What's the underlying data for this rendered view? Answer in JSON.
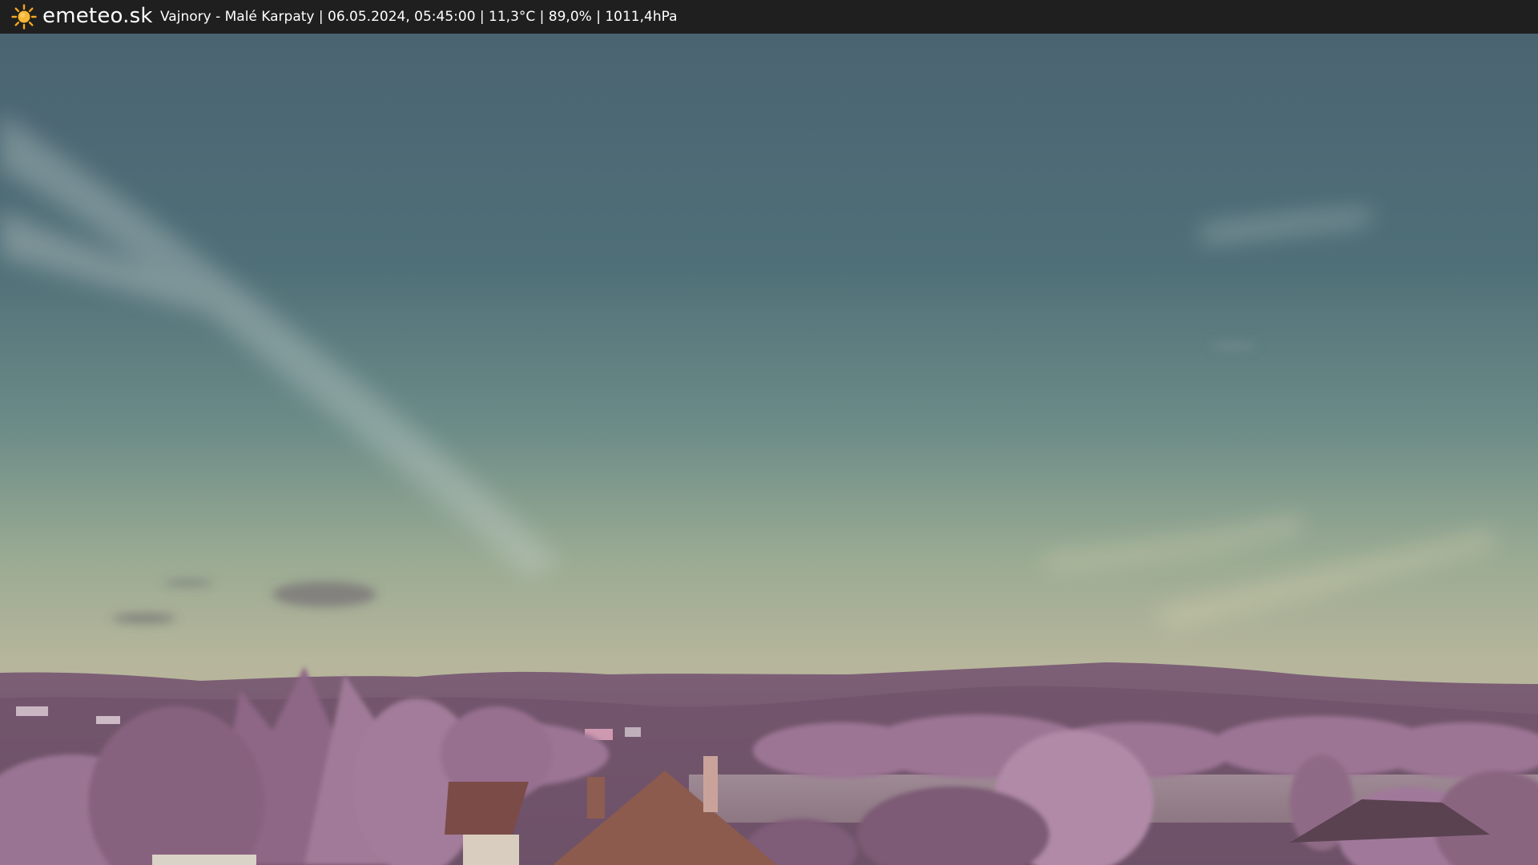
{
  "header": {
    "brand": "emeteo.sk",
    "location": "Vajnory - Malé Karpaty",
    "datetime": "06.05.2024, 05:45:00",
    "temperature": "11,3°C",
    "humidity": "89,0%",
    "pressure": "1011,4hPa",
    "info_line": "Vajnory - Malé Karpaty | 06.05.2024, 05:45:00 | 11,3°C | 89,0% | 1011,4hPa",
    "logo_icon": "sun-icon"
  },
  "colors": {
    "bar": "#1f1f1f",
    "sun": "#f5a623",
    "sky_top": "#4f6a78",
    "sky_mid": "#6f8f8a",
    "sky_horizon": "#b6b99a",
    "hills": "#8a6a80",
    "foliage": "#a57f9c",
    "roof": "#7a4a44"
  }
}
